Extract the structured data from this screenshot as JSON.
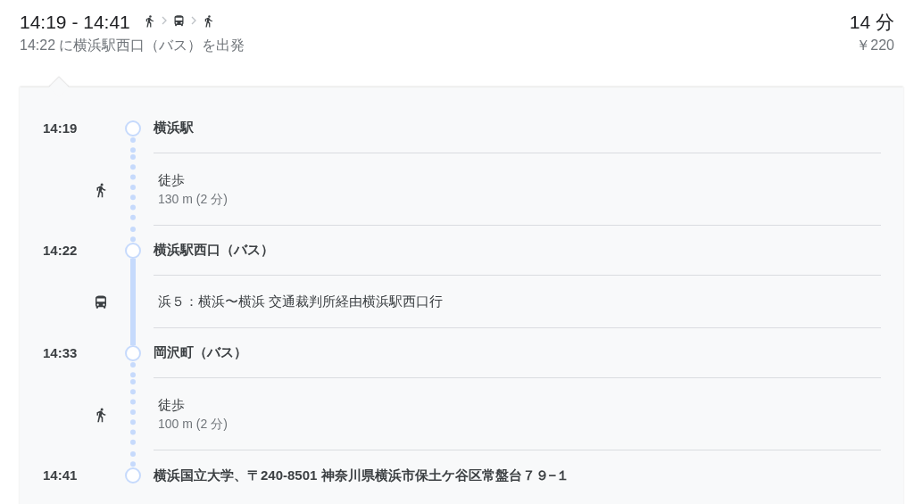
{
  "header": {
    "time_range": "14:19 - 14:41",
    "modes": [
      {
        "kind": "walk"
      },
      {
        "kind": "bus"
      },
      {
        "kind": "walk"
      }
    ],
    "departure": "14:22 に横浜駅西口（バス）を出発",
    "duration": "14 分",
    "fare": "￥220"
  },
  "timeline": [
    {
      "kind": "stop",
      "time": "14:19",
      "name": "横浜駅"
    },
    {
      "kind": "walk",
      "title": "徒歩",
      "detail": "130 m (2 分)"
    },
    {
      "kind": "stop",
      "time": "14:22",
      "name": "横浜駅西口（バス）"
    },
    {
      "kind": "bus",
      "title": "浜５：横浜〜横浜 交通裁判所経由横浜駅西口行"
    },
    {
      "kind": "stop",
      "time": "14:33",
      "name": "岡沢町（バス）"
    },
    {
      "kind": "walk",
      "title": "徒歩",
      "detail": "100 m (2 分)"
    },
    {
      "kind": "stop",
      "time": "14:41",
      "name": "横浜国立大学、〒240-8501 神奈川県横浜市保土ケ谷区常盤台７９−１"
    }
  ]
}
